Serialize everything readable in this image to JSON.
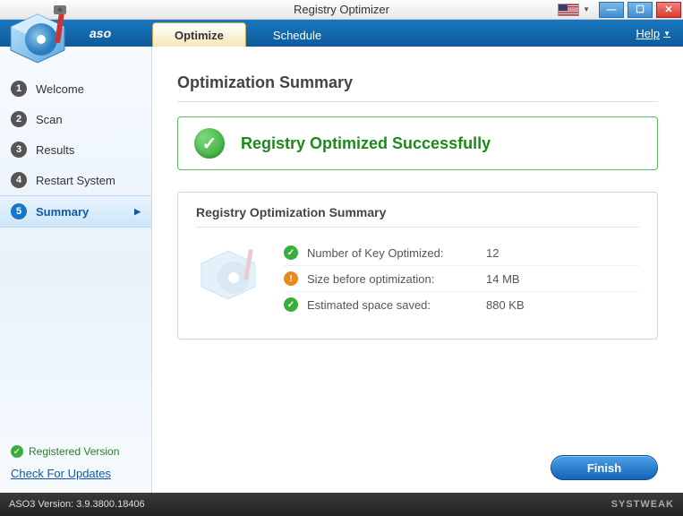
{
  "window": {
    "title": "Registry Optimizer"
  },
  "menubar": {
    "brand": "aso",
    "tabs": [
      {
        "label": "Optimize",
        "active": true
      },
      {
        "label": "Schedule",
        "active": false
      }
    ],
    "help": "Help"
  },
  "sidebar": {
    "steps": [
      {
        "num": "1",
        "label": "Welcome"
      },
      {
        "num": "2",
        "label": "Scan"
      },
      {
        "num": "3",
        "label": "Results"
      },
      {
        "num": "4",
        "label": "Restart System"
      },
      {
        "num": "5",
        "label": "Summary"
      }
    ],
    "active_index": 4,
    "registered": "Registered Version",
    "updates": "Check For Updates"
  },
  "main": {
    "heading": "Optimization Summary",
    "success": "Registry Optimized Successfully",
    "summary_title": "Registry Optimization Summary",
    "rows": [
      {
        "icon": "green",
        "label": "Number of Key Optimized:",
        "value": "12"
      },
      {
        "icon": "orange",
        "label": "Size before optimization:",
        "value": "14 MB"
      },
      {
        "icon": "green",
        "label": "Estimated space saved:",
        "value": "880 KB"
      }
    ],
    "finish": "Finish"
  },
  "statusbar": {
    "version": "ASO3 Version: 3.9.3800.18406",
    "brand": "SYSTWEAK"
  }
}
